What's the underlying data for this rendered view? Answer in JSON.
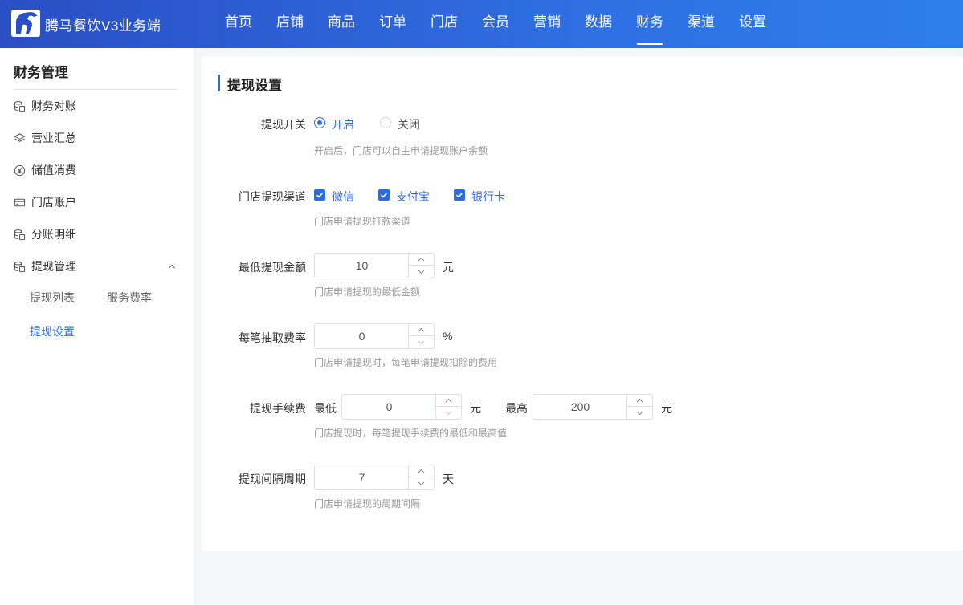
{
  "header": {
    "brand": "腾马餐饮V3业务端",
    "nav": [
      "首页",
      "店铺",
      "商品",
      "订单",
      "门店",
      "会员",
      "营销",
      "数据",
      "财务",
      "渠道",
      "设置"
    ],
    "active_nav": "财务"
  },
  "sidebar": {
    "title": "财务管理",
    "items": [
      {
        "label": "财务对账",
        "icon": "coin-stack-icon"
      },
      {
        "label": "营业汇总",
        "icon": "layers-icon"
      },
      {
        "label": "储值消费",
        "icon": "yen-circle-icon"
      },
      {
        "label": "门店账户",
        "icon": "card-icon"
      },
      {
        "label": "分账明细",
        "icon": "coin-stack-icon"
      },
      {
        "label": "提现管理",
        "icon": "coin-stack-icon"
      }
    ],
    "sub_items": [
      "提现列表",
      "服务费率",
      "提现设置"
    ],
    "active_sub": "提现设置"
  },
  "form": {
    "title": "提现设置",
    "switch": {
      "label": "提现开关",
      "options": [
        "开启",
        "关闭"
      ],
      "selected": "开启",
      "hint": "开启后，门店可以自主申请提现账户余额"
    },
    "channels": {
      "label": "门店提现渠道",
      "options": [
        "微信",
        "支付宝",
        "银行卡"
      ],
      "hint": "门店申请提现打款渠道"
    },
    "min_amount": {
      "label": "最低提现金额",
      "value": "10",
      "unit": "元",
      "hint": "门店申请提现的最低金额"
    },
    "fee_rate": {
      "label": "每笔抽取费率",
      "value": "0",
      "unit": "%",
      "hint": "门店申请提现时，每笔申请提现扣除的费用"
    },
    "handling_fee": {
      "label": "提现手续费",
      "min_label": "最低",
      "min_value": "0",
      "min_unit": "元",
      "max_label": "最高",
      "max_value": "200",
      "max_unit": "元",
      "hint": "门店提现时，每笔提现手续费的最低和最高值"
    },
    "interval": {
      "label": "提现间隔周期",
      "value": "7",
      "unit": "天",
      "hint": "门店申请提现的周期间隔"
    }
  },
  "colors": {
    "primary": "#2d6be4",
    "header_start": "#2a4fc4",
    "header_end": "#2d7eea"
  }
}
